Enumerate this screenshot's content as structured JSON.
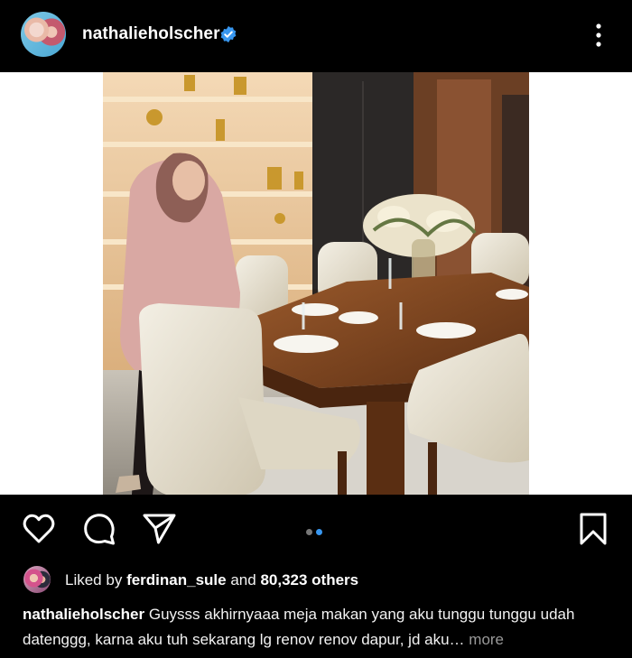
{
  "header": {
    "username": "nathalieholscher",
    "verified": true,
    "menu_icon": "more-vertical-icon"
  },
  "post": {
    "carousel": {
      "current": 2,
      "total": 2
    },
    "image_description_icon": "dining-room-photo"
  },
  "actions": {
    "like_icon": "heart-icon",
    "comment_icon": "comment-icon",
    "share_icon": "send-icon",
    "save_icon": "bookmark-icon"
  },
  "likes": {
    "prefix": "Liked by",
    "user": "ferdinan_sule",
    "joiner": "and",
    "count": "80,323 others"
  },
  "caption": {
    "username": "nathalieholscher",
    "text": "Guysss akhirnyaaa meja makan yang aku  tunggu tunggu udah datenggg, karna aku tuh sekarang lg renov renov dapur, jd aku",
    "ellipsis": "…",
    "more": "more"
  },
  "colors": {
    "background": "#000000",
    "verified_blue": "#3897f0",
    "dot_active": "#3897f0",
    "dot_inactive": "#777777",
    "muted_text": "#9a9a9a"
  }
}
